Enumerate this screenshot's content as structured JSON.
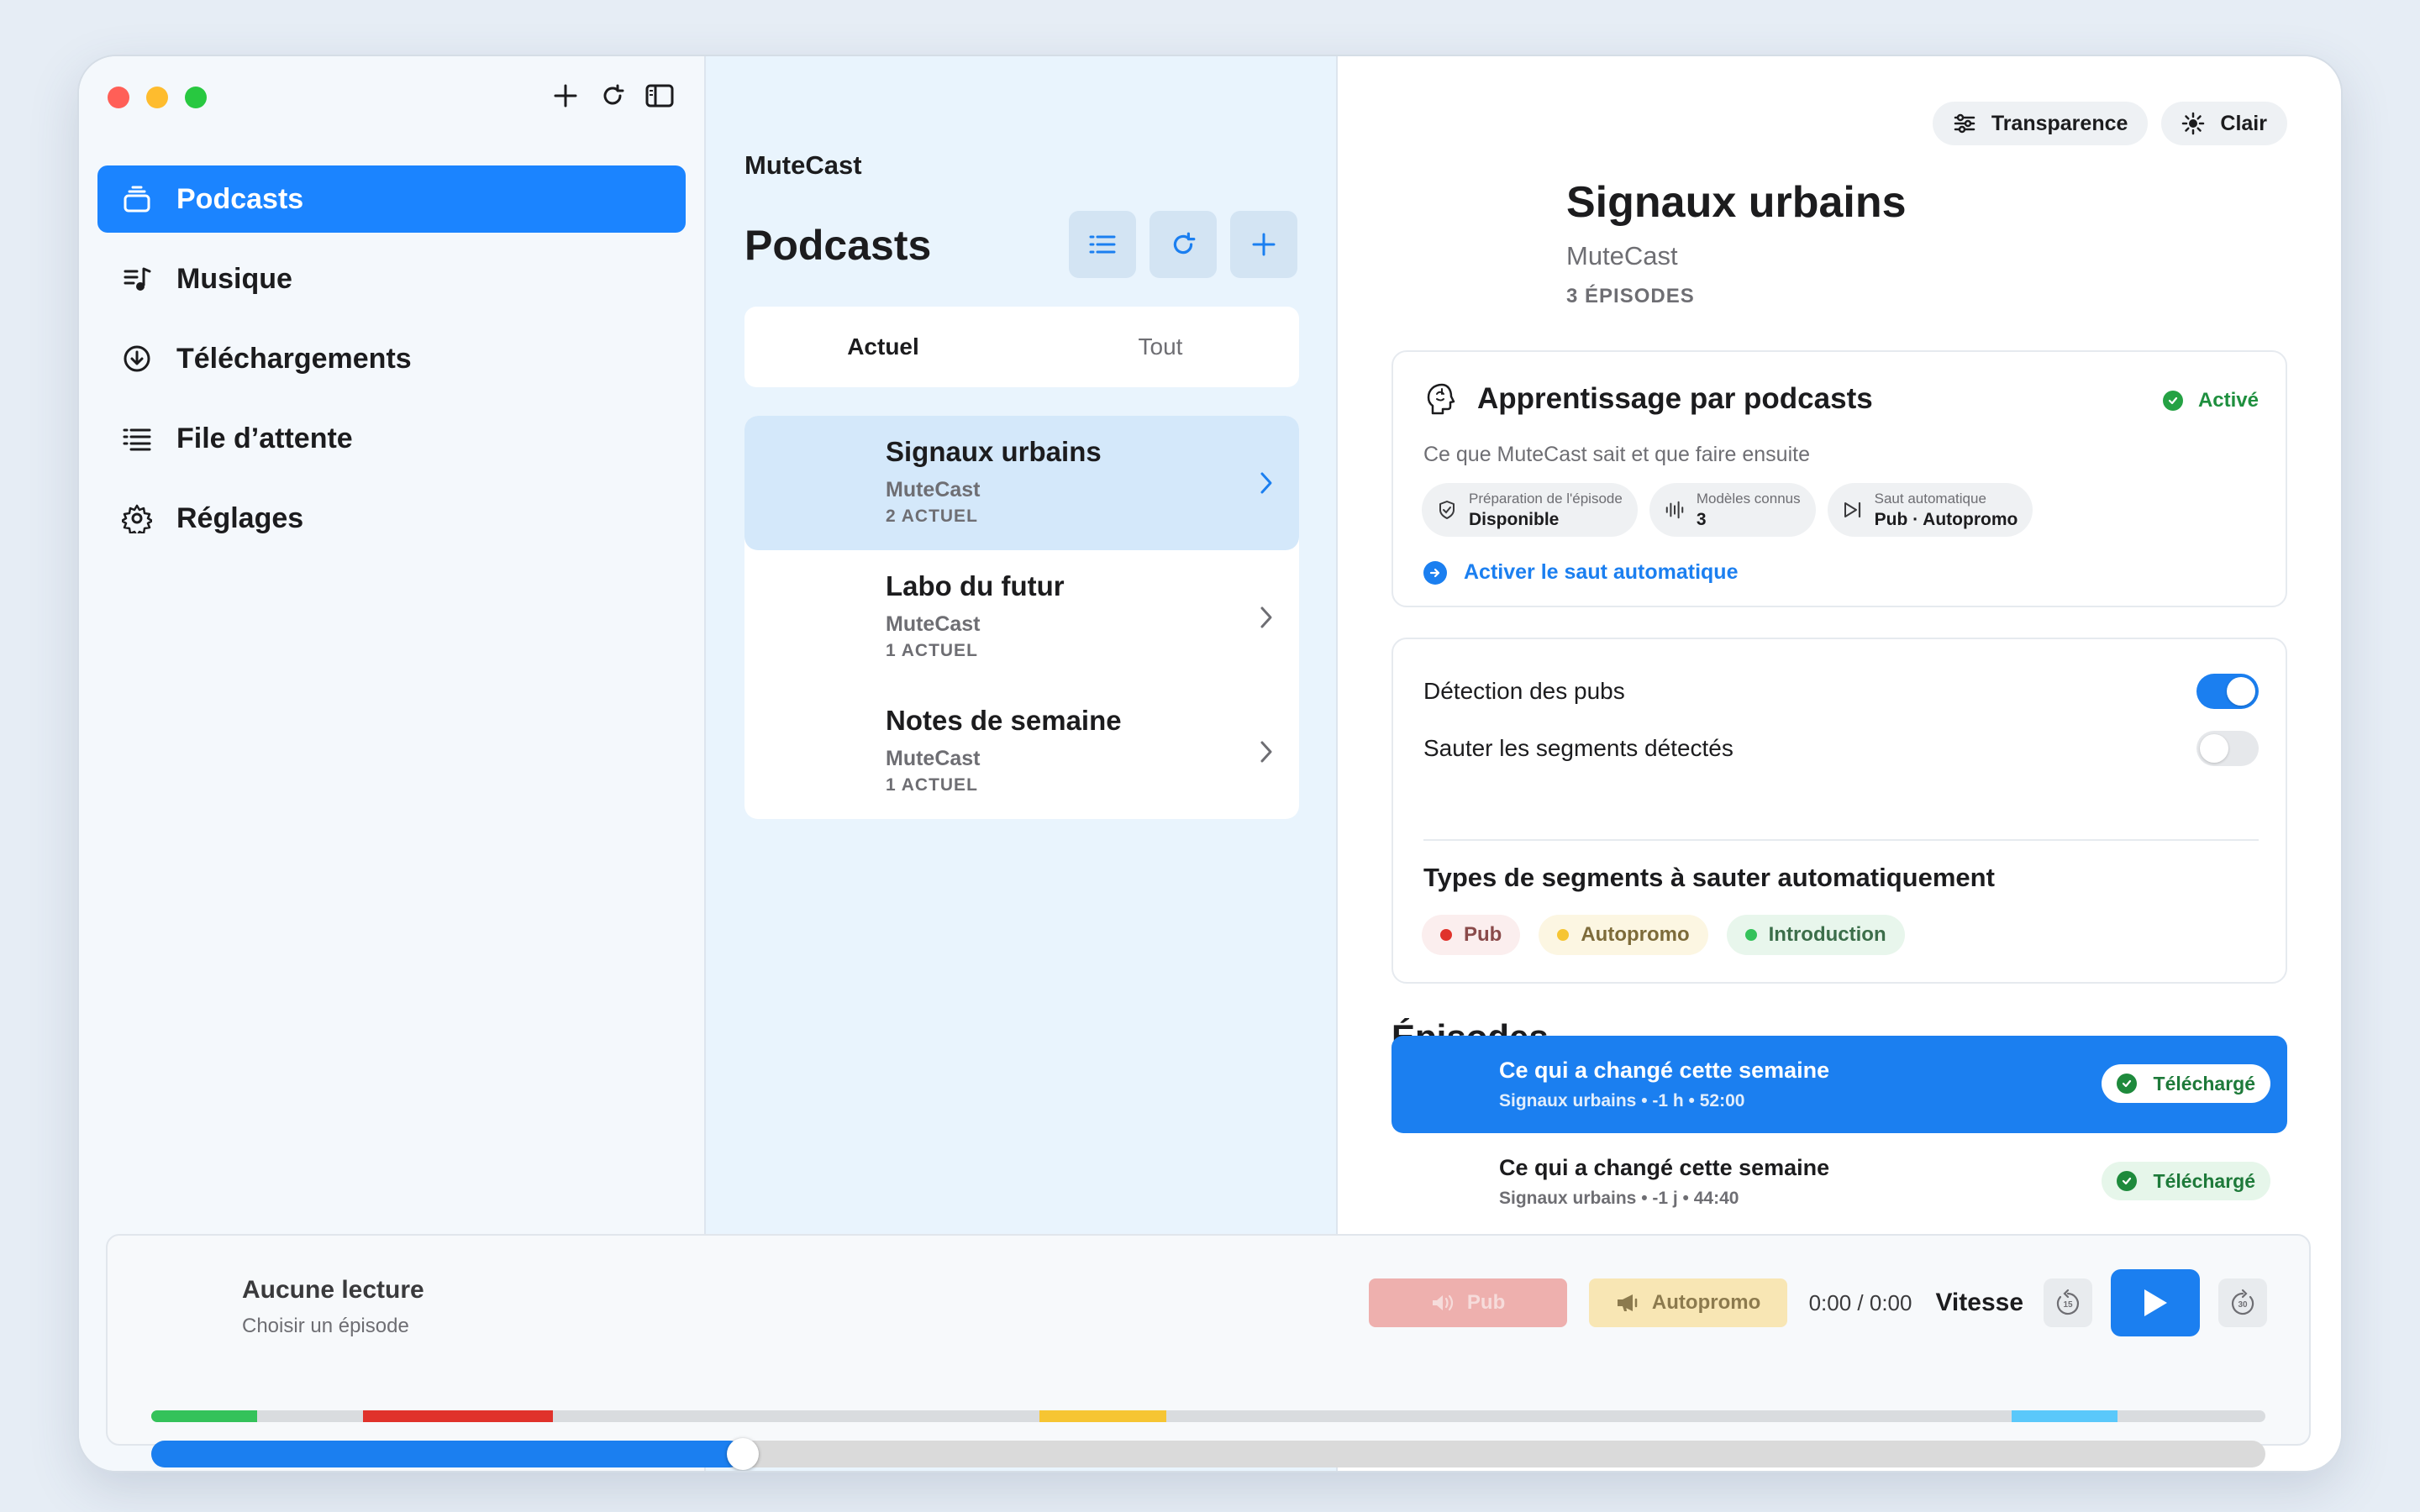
{
  "sidebar": {
    "tools": [
      "plus-icon",
      "refresh-icon",
      "sidebar-toggle-icon"
    ],
    "items": [
      {
        "label": "Podcasts",
        "icon": "podcasts-icon",
        "active": true
      },
      {
        "label": "Musique",
        "icon": "music-icon",
        "active": false
      },
      {
        "label": "Téléchargements",
        "icon": "download-icon",
        "active": false
      },
      {
        "label": "File d’attente",
        "icon": "queue-icon",
        "active": false
      },
      {
        "label": "Réglages",
        "icon": "gear-icon",
        "active": false
      }
    ]
  },
  "middle": {
    "app_name": "MuteCast",
    "title": "Podcasts",
    "tabs": {
      "current": "Actuel",
      "all": "Tout"
    },
    "podcasts": [
      {
        "title": "Signaux urbains",
        "author": "MuteCast",
        "count": "2 ACTUEL",
        "selected": true
      },
      {
        "title": "Labo du futur",
        "author": "MuteCast",
        "count": "1 ACTUEL",
        "selected": false
      },
      {
        "title": "Notes de semaine",
        "author": "MuteCast",
        "count": "1 ACTUEL",
        "selected": false
      }
    ]
  },
  "detail": {
    "pills": {
      "transparency": "Transparence",
      "theme": "Clair"
    },
    "title": "Signaux urbains",
    "author": "MuteCast",
    "episode_count": "3 ÉPISODES",
    "learning": {
      "title": "Apprentissage par podcasts",
      "status": "Activé",
      "description": "Ce que MuteCast sait et que faire ensuite",
      "chips": [
        {
          "label": "Préparation de l'épisode",
          "value": "Disponible"
        },
        {
          "label": "Modèles connus",
          "value": "3"
        },
        {
          "label": "Saut automatique",
          "value": "Pub · Autopromo"
        }
      ],
      "action": "Activer le saut automatique"
    },
    "settings": {
      "ad_detection": "Détection des pubs",
      "ad_detection_on": true,
      "skip_detected": "Sauter les segments détectés",
      "skip_detected_on": false,
      "types_heading": "Types de segments à sauter automatiquement",
      "types": {
        "pub": "Pub",
        "autopromo": "Autopromo",
        "intro": "Introduction"
      },
      "type_colors": {
        "pub": "#e0322b",
        "autopromo": "#f6c533",
        "intro": "#34c25a"
      }
    },
    "episodes_heading": "Épisodes",
    "episodes": [
      {
        "title": "Ce qui a changé cette semaine",
        "meta": "Signaux urbains • -1 h • 52:00",
        "badge": "Téléchargé",
        "selected": true
      },
      {
        "title": "Ce qui a changé cette semaine",
        "meta": "Signaux urbains • -1 j • 44:40",
        "badge": "Téléchargé",
        "selected": false
      }
    ]
  },
  "player": {
    "title": "Aucune lecture",
    "subtitle": "Choisir un épisode",
    "pub": "Pub",
    "autopromo": "Autopromo",
    "time": "0:00 / 0:00",
    "speed": "Vitesse",
    "skip_back_seconds": "15",
    "skip_forward_seconds": "30",
    "progress": 0.28
  },
  "colors": {
    "accent": "#1b84ff",
    "success": "#25a244"
  }
}
